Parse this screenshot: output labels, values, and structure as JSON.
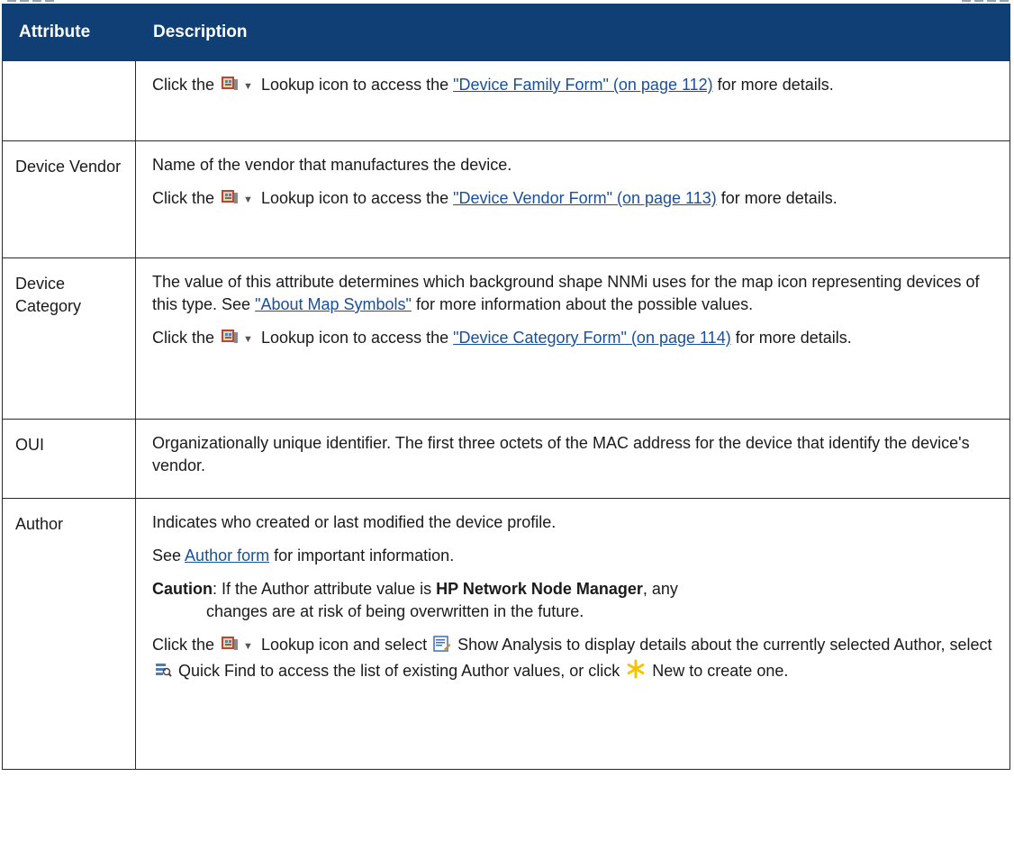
{
  "header": {
    "col1": "Attribute",
    "col2": "Description"
  },
  "rows": [
    {
      "attr": "",
      "p1": {
        "pre": "Click the",
        "mid": "Lookup icon to access the",
        "link": "\"Device Family Form\" (on page 112)",
        "post": "for more details."
      }
    },
    {
      "attr": "Device Vendor",
      "p0": "Name of the vendor that manufactures the device.",
      "p1": {
        "pre": "Click the",
        "mid": "Lookup icon to access the",
        "link": "\"Device Vendor Form\" (on page 113)",
        "post": "for more details."
      }
    },
    {
      "attr": "Device Category",
      "p0": {
        "pre": "The value of this attribute determines which background shape NNMi uses for the map icon representing devices of this type. See",
        "link": "\"About Map Symbols\"",
        "post": "for more information about the possible values."
      },
      "p1": {
        "pre": "Click the",
        "mid": "Lookup icon to access the",
        "link": "\"Device Category Form\" (on page 114)",
        "post": "for more details."
      }
    },
    {
      "attr": "OUI",
      "p0": "Organizationally unique identifier. The first three octets of the MAC address for the device that identify the device's vendor."
    },
    {
      "attr": "Author",
      "p0": "Indicates who created or last modified the device profile.",
      "p1": {
        "pre": "See",
        "link": "Author form",
        "post": "for important information."
      },
      "caution": {
        "label": "Caution",
        "pre": ": If the Author attribute value is",
        "bold": "HP Network Node Manager",
        "post": ", any",
        "cont": "changes are at risk of being overwritten in the future."
      },
      "p3": {
        "pre": "Click the",
        "mid": "Lookup icon and select",
        "show_analysis": "Show Analysis to display details about the currently selected Author, select",
        "quick_find": "Quick Find to access the list of existing Author values, or click",
        "new": "New to create one."
      }
    }
  ],
  "icons": {
    "lookup": "lookup-icon",
    "show_analysis": "show-analysis-icon",
    "quick_find": "quick-find-icon",
    "new": "new-star-icon"
  },
  "colors": {
    "header_bg": "#0f3f74",
    "link": "#1a4f9a",
    "star": "#f5c400"
  }
}
